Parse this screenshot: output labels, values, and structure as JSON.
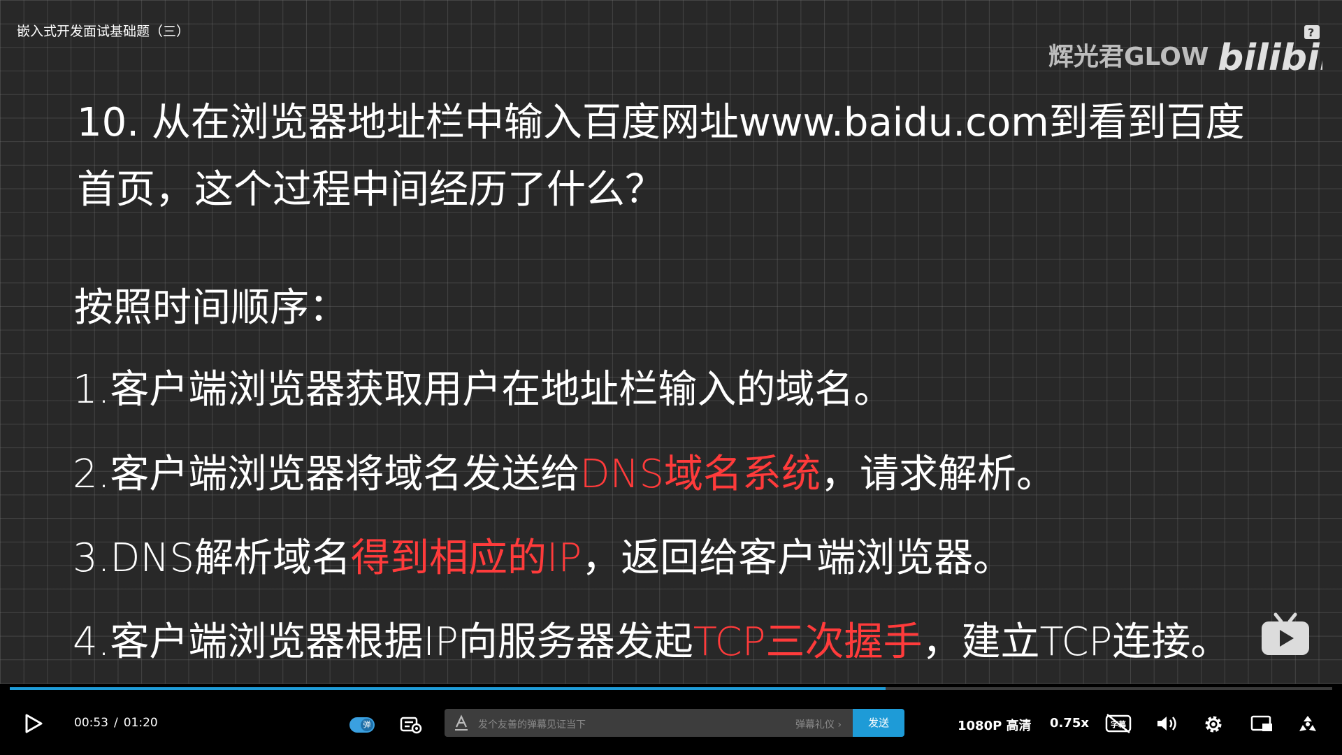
{
  "video": {
    "title": "嵌入式开发面试基础题（三）",
    "watermark": {
      "author": "辉光君GLOW",
      "brand": "bilibili"
    },
    "question": "10.  从在浏览器地址栏中输入百度网址www.baidu.com到看到百度首页，这个过程中间经历了什么？",
    "order_title": "按照时间顺序：",
    "steps": [
      {
        "a": "1.客户端浏览器获取用户在地址栏输入的域名。",
        "red": "",
        "b": ""
      },
      {
        "a": "2.客户端浏览器将域名发送给",
        "red": "DNS域名系统",
        "b": "，请求解析。"
      },
      {
        "a": "3.DNS解析域名",
        "red": "得到相应的IP",
        "b": "，返回给客户端浏览器。"
      },
      {
        "a": "4.客户端浏览器根据IP向服务器发起",
        "red": "TCP三次握手",
        "b": "，建立TCP连接。"
      }
    ]
  },
  "player": {
    "progress": 0.6625,
    "time_current": "00:53",
    "time_separator": "/",
    "time_total": "01:20",
    "danmaku_toggle_label": "弹",
    "danmaku_placeholder": "发个友善的弹幕见证当下",
    "danmaku_etiquette": "弹幕礼仪 ›",
    "send_label": "发送",
    "quality": "1080P 高清",
    "speed": "0.75x",
    "subtitle_badge": "字幕",
    "colors": {
      "accent": "#1e9bd7",
      "highlight": "#ff3b3b"
    },
    "icons": [
      "play-icon",
      "danmaku-settings-icon",
      "danmaku-style-icon",
      "subtitle-off-icon",
      "volume-icon",
      "gear-icon",
      "pip-icon",
      "widescreen-icon",
      "tv-icon"
    ]
  }
}
